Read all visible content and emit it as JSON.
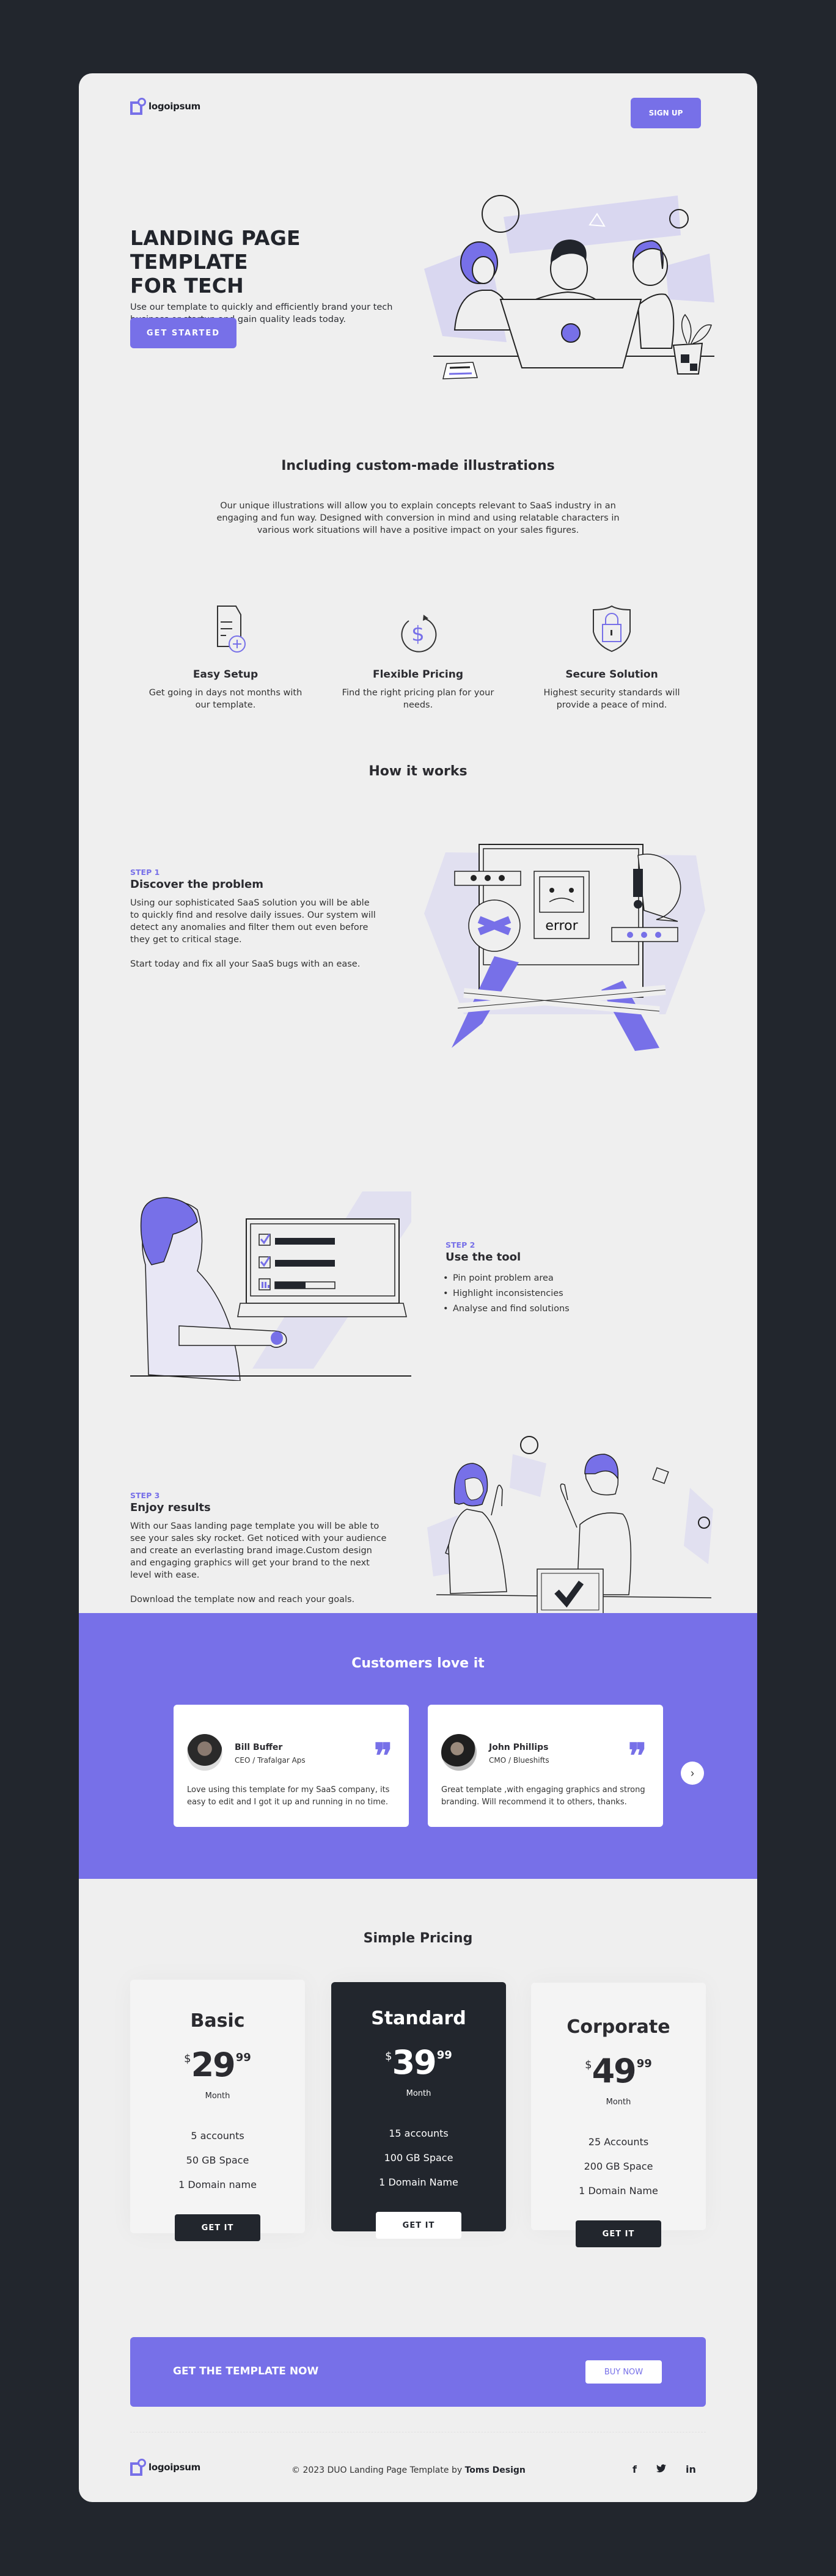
{
  "header": {
    "logo_text": "logoipsum",
    "signup_label": "SIGN UP"
  },
  "hero": {
    "title_line1": "LANDING PAGE TEMPLATE",
    "title_line2": "FOR TECH",
    "subtitle": "Use our template to quickly and efficiently brand your tech business or startup and gain quality leads today.",
    "cta_label": "GET STARTED"
  },
  "intro": {
    "title": "Including custom-made illustrations",
    "body": "Our unique illustrations will allow you to explain concepts relevant to SaaS industry in an engaging and fun way. Designed with conversion in mind and using relatable characters in various work situations will have a positive impact on your sales figures."
  },
  "features": [
    {
      "icon": "document-plus-icon",
      "title": "Easy Setup",
      "text": "Get going in days not months with our template."
    },
    {
      "icon": "dollar-cycle-icon",
      "title": "Flexible Pricing",
      "text": "Find the right pricing plan for your needs."
    },
    {
      "icon": "shield-lock-icon",
      "title": "Secure Solution",
      "text": "Highest security standards will provide a peace of mind."
    }
  ],
  "how_it_works": {
    "title": "How it works",
    "steps": [
      {
        "label": "STEP 1",
        "title": "Discover the problem",
        "paragraphs": [
          "Using our sophisticated SaaS solution you will be able to quickly find and resolve daily issues. Our system will detect any anomalies and filter them out even before they get to critical stage.",
          "Start today and fix all your SaaS bugs with an ease."
        ],
        "illustration_text": "error"
      },
      {
        "label": "STEP 2",
        "title": "Use the tool",
        "bullets": [
          "Pin point problem area",
          "Highlight inconsistencies",
          "Analyse and find solutions"
        ]
      },
      {
        "label": "STEP 3",
        "title": "Enjoy results",
        "paragraphs": [
          "With our Saas landing page template you will be able to see your sales sky rocket. Get noticed with your audience and create an everlasting brand image.Custom design and engaging graphics will get your brand to the next level with ease.",
          "Download the template now and reach your goals."
        ]
      }
    ]
  },
  "testimonials": {
    "title": "Customers love it",
    "items": [
      {
        "name": "Bill Buffer",
        "role": "CEO / Trafalgar Aps",
        "text": "Love using this template for my SaaS company, its easy to edit and I got it up and running in no time."
      },
      {
        "name": "John Phillips",
        "role": "CMO / Blueshifts",
        "text": "Great template ,with engaging graphics and strong branding. Will recommend it to others, thanks."
      }
    ],
    "quote_glyph": "❞",
    "next_glyph": "›"
  },
  "pricing": {
    "title": "Simple Pricing",
    "plans": [
      {
        "name": "Basic",
        "currency": "$",
        "price_int": "29",
        "price_dec": "99",
        "period": "Month",
        "features": [
          "5 accounts",
          "50 GB Space",
          "1 Domain name"
        ],
        "button": "GET IT",
        "highlighted": false
      },
      {
        "name": "Standard",
        "currency": "$",
        "price_int": "39",
        "price_dec": "99",
        "period": "Month",
        "features": [
          "15 accounts",
          "100 GB Space",
          "1 Domain Name"
        ],
        "button": "GET IT",
        "highlighted": true
      },
      {
        "name": "Corporate",
        "currency": "$",
        "price_int": "49",
        "price_dec": "99",
        "period": "Month",
        "features": [
          "25 Accounts",
          "200 GB Space",
          "1 Domain Name"
        ],
        "button": "GET IT",
        "highlighted": false
      }
    ]
  },
  "cta": {
    "title": "GET THE TEMPLATE NOW",
    "button": "BUY NOW"
  },
  "footer": {
    "logo_text": "logoipsum",
    "copyright_prefix": "© 2023 DUO Landing Page Template by ",
    "copyright_author": "Toms Design",
    "social": [
      {
        "name": "facebook-icon",
        "glyph": "f"
      },
      {
        "name": "twitter-icon",
        "glyph": "🐦"
      },
      {
        "name": "linkedin-icon",
        "glyph": "in"
      }
    ]
  },
  "colors": {
    "accent": "#7770e8",
    "dark": "#22262d",
    "page_bg": "#efefef",
    "outer_bg": "#22262d"
  }
}
